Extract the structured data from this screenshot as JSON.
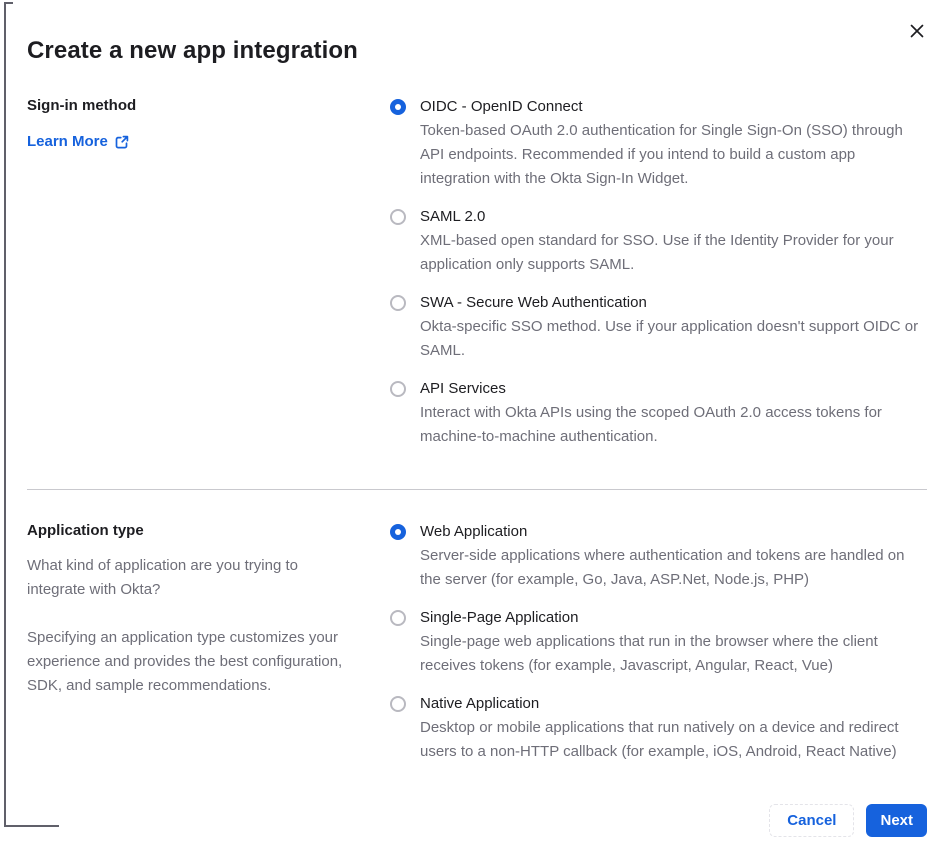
{
  "dialog": {
    "title": "Create a new app integration"
  },
  "signin": {
    "label": "Sign-in method",
    "learn_more_label": "Learn More",
    "options": [
      {
        "label": "OIDC - OpenID Connect",
        "description": "Token-based OAuth 2.0 authentication for Single Sign-On (SSO) through API endpoints. Recommended if you intend to build a custom app integration with the Okta Sign-In Widget.",
        "selected": true
      },
      {
        "label": "SAML 2.0",
        "description": "XML-based open standard for SSO. Use if the Identity Provider for your application only supports SAML.",
        "selected": false
      },
      {
        "label": "SWA - Secure Web Authentication",
        "description": "Okta-specific SSO method. Use if your application doesn't support OIDC or SAML.",
        "selected": false
      },
      {
        "label": "API Services",
        "description": "Interact with Okta APIs using the scoped OAuth 2.0 access tokens for machine-to-machine authentication.",
        "selected": false
      }
    ]
  },
  "apptype": {
    "label": "Application type",
    "paragraphs": [
      "What kind of application are you trying to integrate with Okta?",
      "Specifying an application type customizes your experience and provides the best configuration, SDK, and sample recommendations."
    ],
    "options": [
      {
        "label": "Web Application",
        "description": "Server-side applications where authentication and tokens are handled on the server (for example, Go, Java, ASP.Net, Node.js, PHP)",
        "selected": true
      },
      {
        "label": "Single-Page Application",
        "description": "Single-page web applications that run in the browser where the client receives tokens (for example, Javascript, Angular, React, Vue)",
        "selected": false
      },
      {
        "label": "Native Application",
        "description": "Desktop or mobile applications that run natively on a device and redirect users to a non-HTTP callback (for example, iOS, Android, React Native)",
        "selected": false
      }
    ]
  },
  "footer": {
    "cancel_label": "Cancel",
    "next_label": "Next"
  },
  "icons": {
    "close": "close-icon",
    "external_link": "external-link-icon"
  },
  "colors": {
    "accent_blue": "#1662dd",
    "text_dark": "#1d1d21",
    "text_gray": "#6e6e78",
    "radio_unselected_border": "#b9b9c0",
    "divider": "#c9c9ce"
  }
}
